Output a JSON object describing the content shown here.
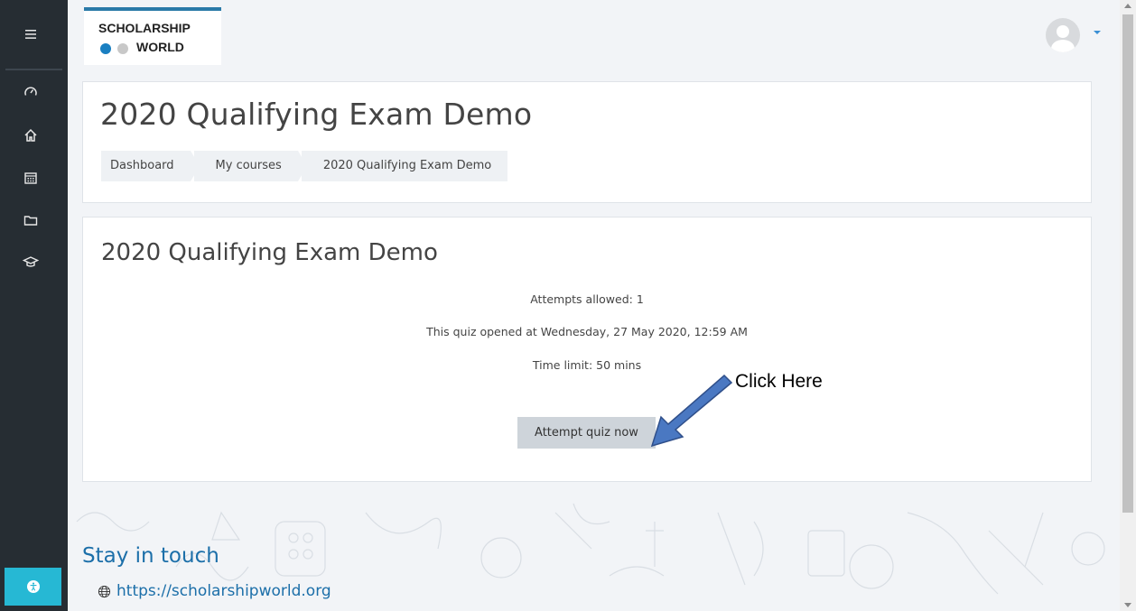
{
  "brand": {
    "line1": "SCHOLARSHIP",
    "line2": "WORLD"
  },
  "page": {
    "title": "2020 Qualifying Exam Demo",
    "breadcrumbs": [
      "Dashboard",
      "My courses",
      "2020 Qualifying Exam Demo"
    ]
  },
  "quiz": {
    "heading": "2020 Qualifying Exam Demo",
    "attempts": "Attempts allowed: 1",
    "opened": "This quiz opened at Wednesday, 27 May 2020, 12:59 AM",
    "time_limit": "Time limit: 50 mins",
    "attempt_button": "Attempt quiz now"
  },
  "annotation": {
    "text": "Click Here",
    "arrow_color": "#4a78c2"
  },
  "footer": {
    "heading": "Stay in touch",
    "website": "https://scholarshipworld.org"
  },
  "sidebar": {
    "icons": [
      "menu-icon",
      "dashboard-icon",
      "home-icon",
      "calendar-icon",
      "folder-icon",
      "graduation-cap-icon",
      "accessibility-icon"
    ]
  },
  "colors": {
    "sidebar": "#262d33",
    "accent": "#26b8d4",
    "link": "#1c6fa9",
    "button": "#ced4da"
  }
}
